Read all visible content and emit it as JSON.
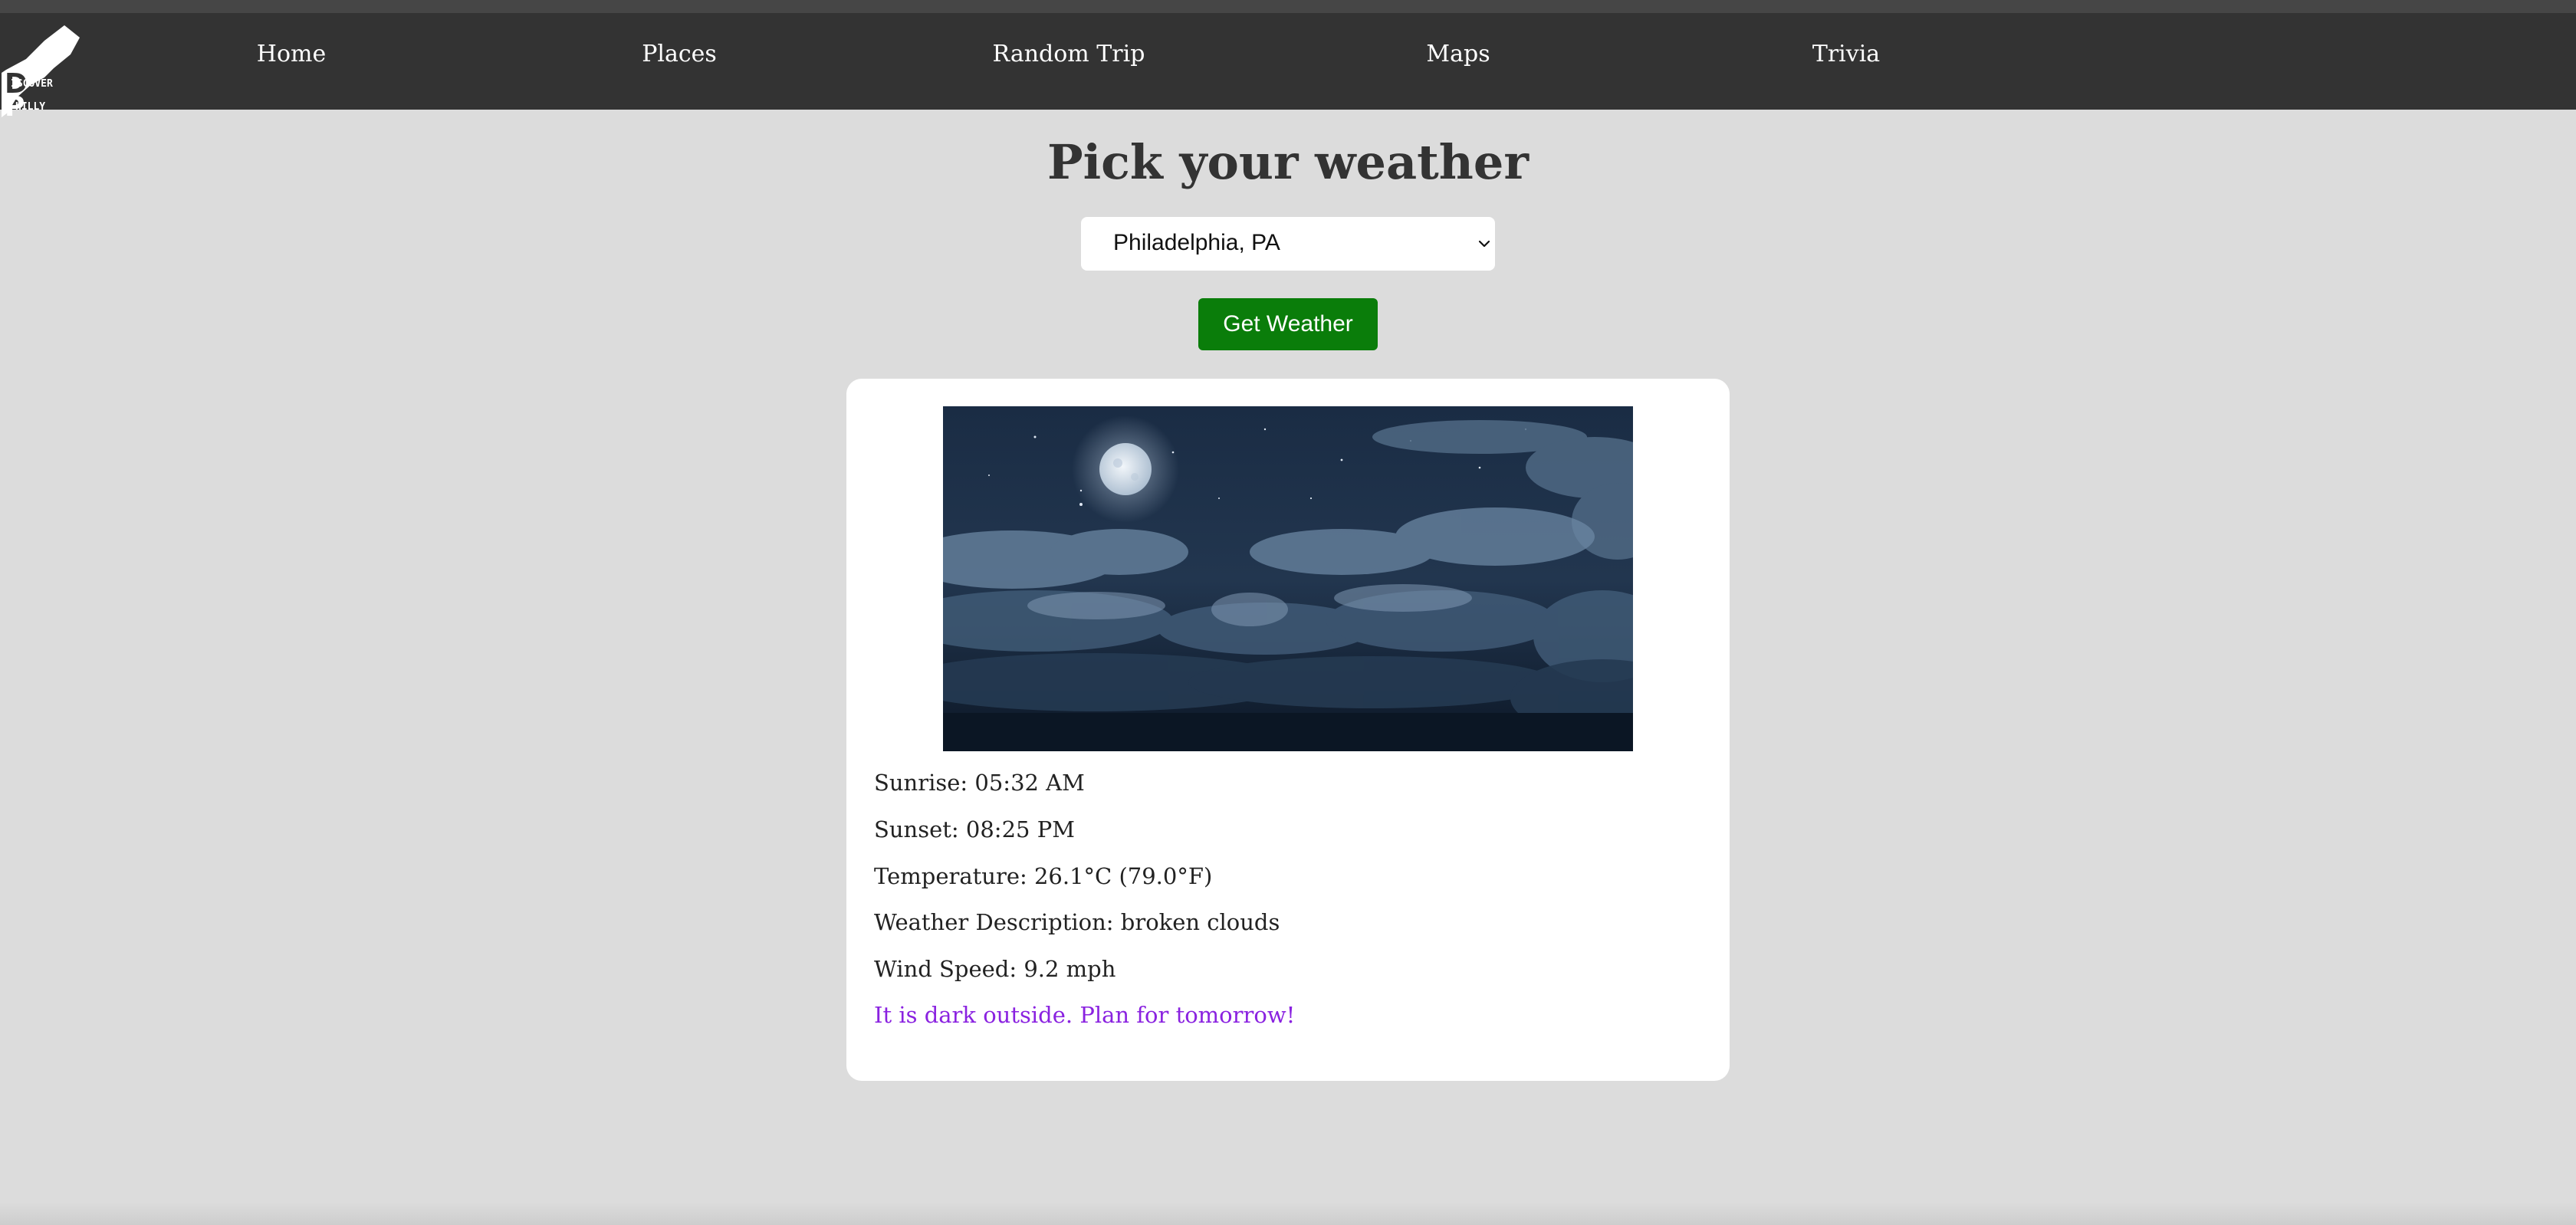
{
  "brand": {
    "logo_line1": "ISCOVER",
    "logo_line2": "HILLY",
    "logo_letter1": "D",
    "logo_letter2": "P"
  },
  "nav": {
    "items": [
      {
        "label": "Home"
      },
      {
        "label": "Places"
      },
      {
        "label": "Random Trip"
      },
      {
        "label": "Maps"
      },
      {
        "label": "Trivia"
      }
    ]
  },
  "main": {
    "title": "Pick your weather",
    "location_select": {
      "selected": "Philadelphia, PA"
    },
    "get_weather_label": "Get Weather"
  },
  "weather": {
    "image_icon": "night-sky-moon-clouds",
    "sunrise": "Sunrise: 05:32 AM",
    "sunset": "Sunset: 08:25 PM",
    "temperature": "Temperature: 26.1°C (79.0°F)",
    "description": "Weather Description: broken clouds",
    "wind_speed": "Wind Speed: 9.2 mph",
    "message": "It is dark outside. Plan for tomorrow!"
  },
  "colors": {
    "navbar": "#333333",
    "background": "#dcdcdc",
    "button": "#0a7d0a",
    "message": "#8a22e0"
  }
}
